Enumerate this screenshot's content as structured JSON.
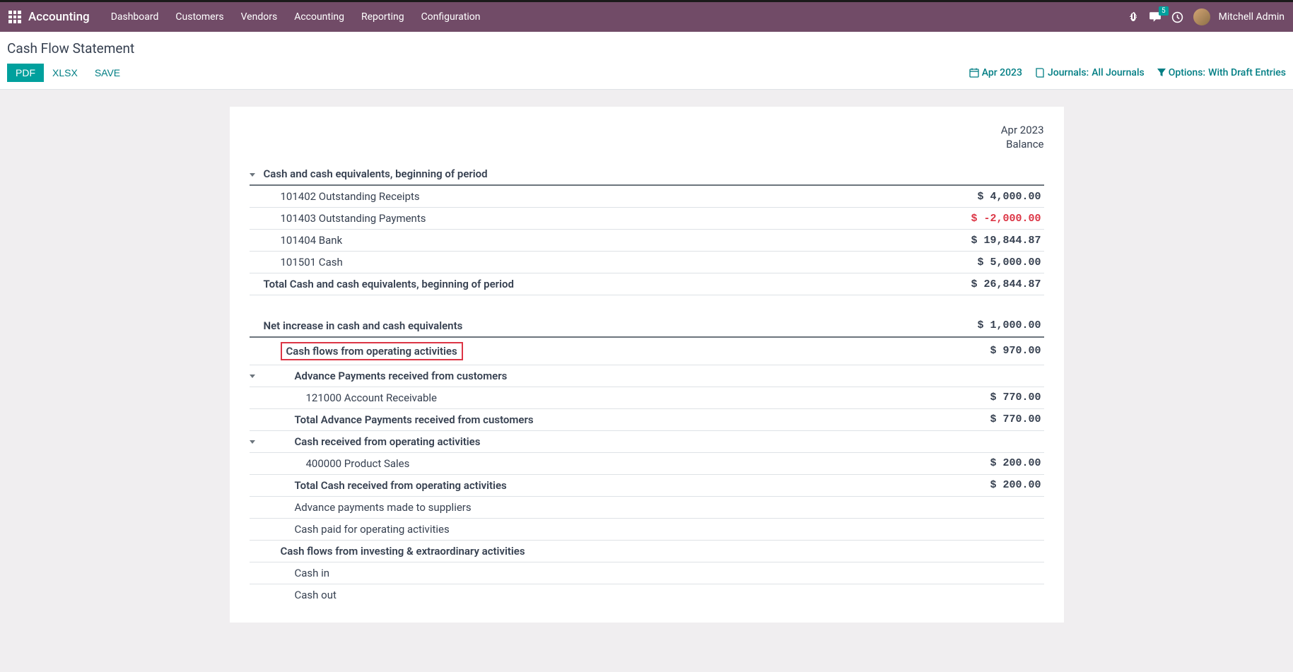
{
  "navbar": {
    "brand": "Accounting",
    "links": [
      "Dashboard",
      "Customers",
      "Vendors",
      "Accounting",
      "Reporting",
      "Configuration"
    ],
    "message_count": "5",
    "user": "Mitchell Admin"
  },
  "page": {
    "title": "Cash Flow Statement",
    "btn_pdf": "PDF",
    "btn_xlsx": "XLSX",
    "btn_save": "SAVE"
  },
  "filters": {
    "period": "Apr 2023",
    "journals_label": "Journals:",
    "journals_value": " All Journals",
    "options_label": "Options:",
    "options_value": "With Draft Entries"
  },
  "report": {
    "period_header": "Apr 2023",
    "balance_label": "Balance",
    "rows": {
      "r1_label": "Cash and cash equivalents, beginning of period",
      "r2_label": "101402 Outstanding Receipts",
      "r2_amount": "$ 4,000.00",
      "r3_label": "101403 Outstanding Payments",
      "r3_amount": "$ -2,000.00",
      "r4_label": "101404 Bank",
      "r4_amount": "$ 19,844.87",
      "r5_label": "101501 Cash",
      "r5_amount": "$ 5,000.00",
      "r6_label": "Total Cash and cash equivalents, beginning of period",
      "r6_amount": "$ 26,844.87",
      "r7_label": "Net increase in cash and cash equivalents",
      "r7_amount": "$ 1,000.00",
      "r8_label": "Cash flows from operating activities",
      "r8_amount": "$ 970.00",
      "r9_label": "Advance Payments received from customers",
      "r10_label": "121000 Account Receivable",
      "r10_amount": "$ 770.00",
      "r11_label": "Total Advance Payments received from customers",
      "r11_amount": "$ 770.00",
      "r12_label": "Cash received from operating activities",
      "r13_label": "400000 Product Sales",
      "r13_amount": "$ 200.00",
      "r14_label": "Total Cash received from operating activities",
      "r14_amount": "$ 200.00",
      "r15_label": "Advance payments made to suppliers",
      "r16_label": "Cash paid for operating activities",
      "r17_label": "Cash flows from investing & extraordinary activities",
      "r18_label": "Cash in",
      "r19_label": "Cash out"
    }
  }
}
